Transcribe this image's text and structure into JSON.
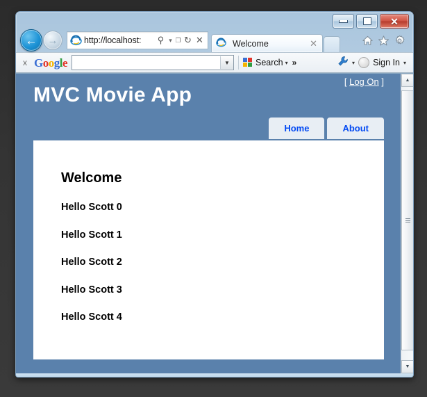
{
  "browser": {
    "window_controls": {
      "minimize": "minimize-button",
      "restore": "restore-button",
      "close_label": "✕"
    },
    "nav": {
      "back_glyph": "←",
      "forward_glyph": "→"
    },
    "address_bar": {
      "url": "http://localhost:",
      "search_icon": "⚲",
      "caret": "▾",
      "compat_icon": "❐",
      "refresh_icon": "↻",
      "stop_icon": "✕"
    },
    "tab": {
      "title": "Welcome",
      "close_glyph": "✕"
    },
    "tools": {
      "home": "home-icon",
      "favorites": "favorites-star-icon",
      "settings": "settings-gear-icon"
    }
  },
  "google_toolbar": {
    "close_label": "x",
    "logo_letters": [
      "G",
      "o",
      "o",
      "g",
      "l",
      "e"
    ],
    "search_value": "",
    "search_placeholder": "",
    "dropdown_glyph": "▼",
    "search_button_label": "Search",
    "caret_glyph": "▾",
    "overflow_glyph": "»",
    "wrench_label": "wrench-icon",
    "signin_label": "Sign In"
  },
  "page": {
    "logon_open": "[",
    "logon_label": "Log On",
    "logon_close": "]",
    "site_title": "MVC Movie App",
    "menu": [
      {
        "label": "Home"
      },
      {
        "label": "About"
      }
    ],
    "heading": "Welcome",
    "lines": [
      "Hello Scott 0",
      "Hello Scott 1",
      "Hello Scott 2",
      "Hello Scott 3",
      "Hello Scott 4"
    ]
  },
  "scrollbar": {
    "up_glyph": "▲",
    "down_glyph": "▼"
  },
  "colors": {
    "header_blue": "#5a81ac",
    "menu_tab_bg": "#e8eef4",
    "link_blue": "#034af3",
    "content_white": "#ffffff"
  }
}
